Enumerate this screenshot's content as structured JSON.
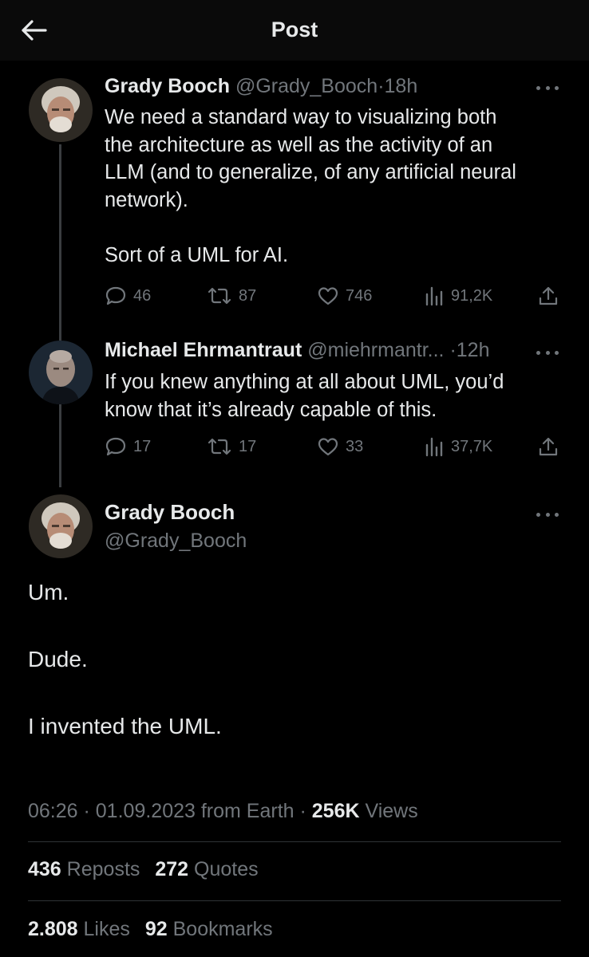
{
  "header": {
    "title": "Post"
  },
  "thread": [
    {
      "name": "Grady Booch",
      "handle": "@Grady_Booch",
      "time": "18h",
      "text": "We need a standard way to visualizing both\nthe architecture as well as the activity of an\nLLM (and to generalize, of any artificial neural\nnetwork).\n\nSort of a UML for AI.",
      "replies": "46",
      "reposts": "87",
      "likes": "746",
      "views": "91,2K"
    },
    {
      "name": "Michael Ehrmantraut",
      "handle": "@miehrmantr...",
      "time": "12h",
      "text": "If you knew anything at all about UML, you’d\nknow that it’s already capable of this.",
      "replies": "17",
      "reposts": "17",
      "likes": "33",
      "views": "37,7K"
    }
  ],
  "main": {
    "name": "Grady Booch",
    "handle": "@Grady_Booch",
    "text": "Um.\n\nDude.\n\nI invented the UML.",
    "time": "06:26",
    "date": "01.09.2023",
    "source": "from Earth",
    "views_count": "256K",
    "views_label": "Views",
    "reposts_count": "436",
    "reposts_label": "Reposts",
    "quotes_count": "272",
    "quotes_label": "Quotes",
    "likes_count": "2.808",
    "likes_label": "Likes",
    "bookmarks_count": "92",
    "bookmarks_label": "Bookmarks"
  },
  "icons": {
    "back": "arrow-left-icon",
    "more": "more-horizontal-icon",
    "reply": "reply-bubble-icon",
    "repost": "repost-arrows-icon",
    "like": "heart-icon",
    "views": "views-bars-icon",
    "share": "share-upload-icon"
  },
  "colors": {
    "background": "#000000",
    "text": "#e7e9ea",
    "muted": "#71767b",
    "divider": "#2f3336"
  }
}
